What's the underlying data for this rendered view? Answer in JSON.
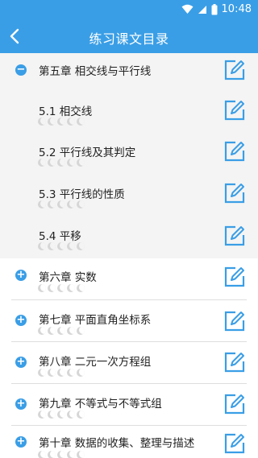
{
  "status": {
    "time": "10:48",
    "icons": [
      "wifi-icon",
      "signal-icon",
      "battery-icon"
    ]
  },
  "header": {
    "title": "练习课文目录",
    "back_icon": "back-arrow-icon"
  },
  "colors": {
    "accent": "#3a9ee6",
    "moon": "#d6d6d6",
    "divider": "#dedede"
  },
  "items": [
    {
      "kind": "chapter",
      "expanded": true,
      "label": "第五章 相交线与平行线",
      "toggle": "−"
    },
    {
      "kind": "section",
      "label": "5.1 相交线"
    },
    {
      "kind": "section",
      "label": "5.2 平行线及其判定"
    },
    {
      "kind": "section",
      "label": "5.3 平行线的性质"
    },
    {
      "kind": "section",
      "label": "5.4 平移"
    },
    {
      "kind": "chapter",
      "expanded": false,
      "label": "第六章 实数",
      "toggle": "+"
    },
    {
      "kind": "chapter",
      "expanded": false,
      "label": "第七章 平面直角坐标系",
      "toggle": "+"
    },
    {
      "kind": "chapter",
      "expanded": false,
      "label": "第八章 二元一次方程组",
      "toggle": "+"
    },
    {
      "kind": "chapter",
      "expanded": false,
      "label": "第九章 不等式与不等式组",
      "toggle": "+"
    },
    {
      "kind": "chapter",
      "expanded": false,
      "label": "第十章 数据的收集、整理与描述",
      "toggle": "+"
    }
  ]
}
